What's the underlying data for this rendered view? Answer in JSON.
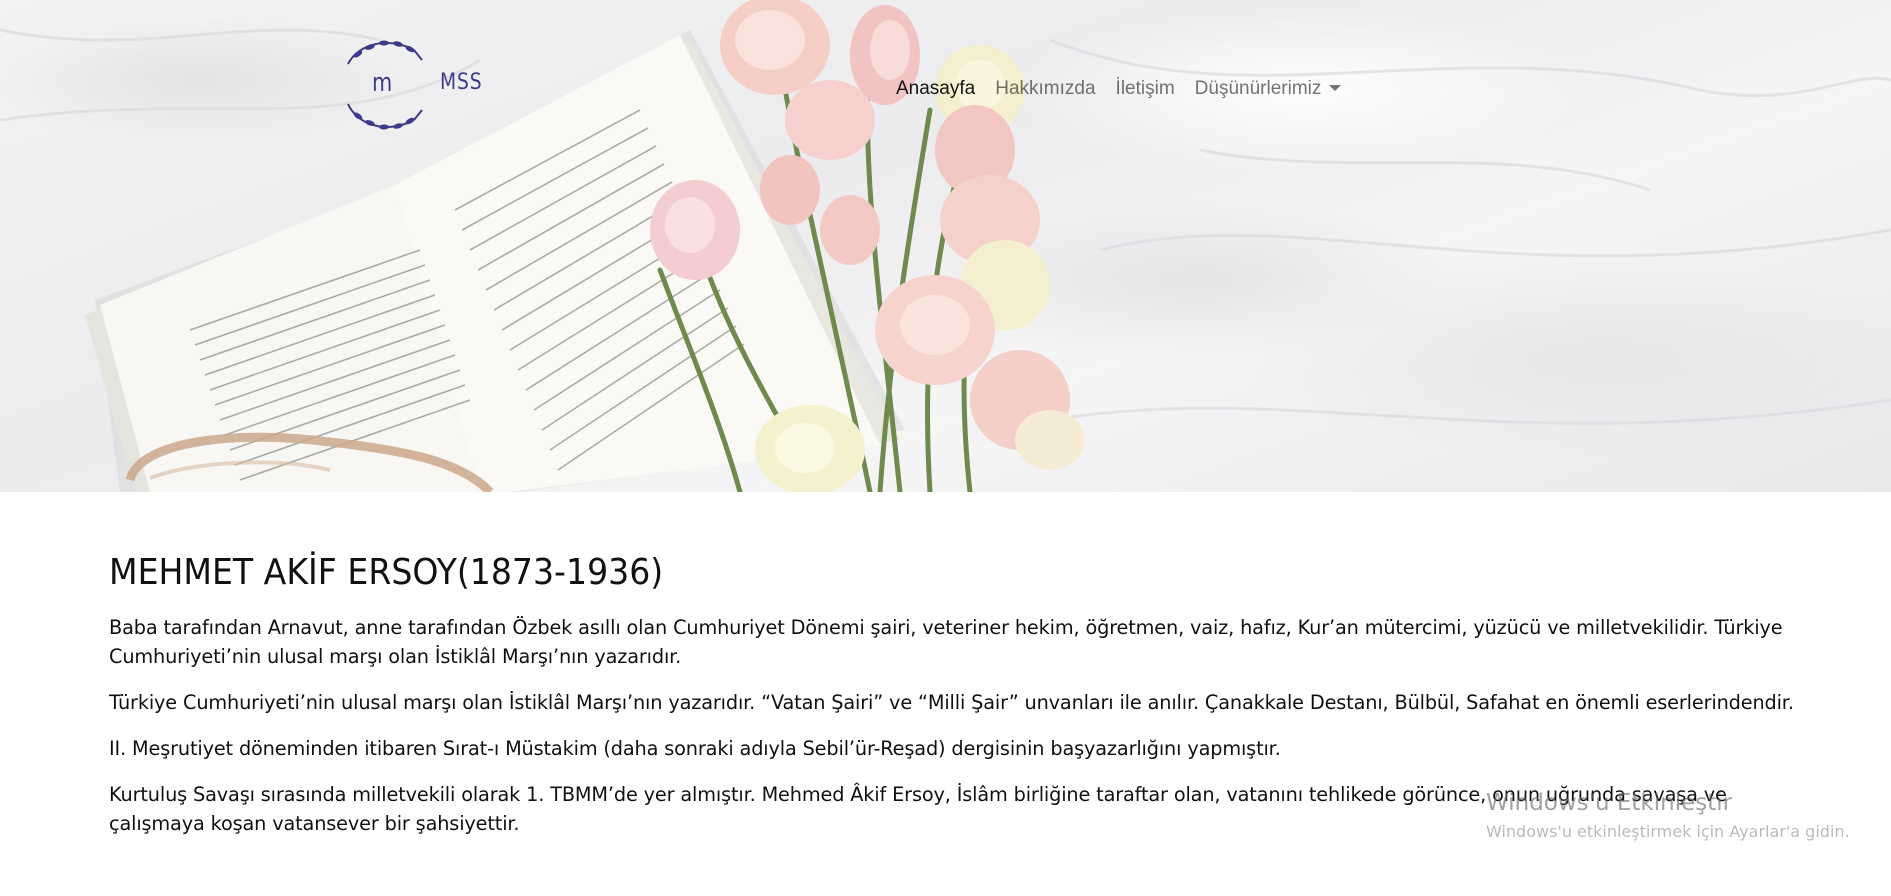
{
  "brand": {
    "logo_letter": "m",
    "logo_text": "MSS",
    "accent_color": "#3d3a8a"
  },
  "nav": {
    "items": [
      {
        "label": "Anasayfa",
        "active": true
      },
      {
        "label": "Hakkımızda",
        "active": false
      },
      {
        "label": "İletişim",
        "active": false
      },
      {
        "label": "Düşünürlerimiz",
        "active": false,
        "dropdown": true
      }
    ]
  },
  "hero": {
    "image": "book-flowers-glasses-photo"
  },
  "article": {
    "title": "MEHMET AKİF ERSOY(1873-1936)",
    "paragraphs": [
      "Baba tarafından Arnavut, anne tarafından Özbek asıllı olan Cumhuriyet Dönemi şairi, veteriner hekim, öğretmen, vaiz, hafız, Kur’an mütercimi, yüzücü ve milletvekilidir. Türkiye Cumhuriyeti’nin ulusal marşı olan İstiklâl Marşı’nın yazarıdır.",
      "Türkiye Cumhuriyeti’nin ulusal marşı olan İstiklâl Marşı’nın yazarıdır. “Vatan Şairi” ve “Milli Şair” unvanları ile anılır. Çanakkale Destanı, Bülbül, Safahat en önemli eserlerindendir.",
      "II. Meşrutiyet döneminden itibaren Sırat-ı Müstakim (daha sonraki adıyla Sebil’ür-Reşad) dergisinin başyazarlığını yapmıştır.",
      "Kurtuluş Savaşı sırasında milletvekili olarak 1. TBMM’de yer almıştır. Mehmed Âkif Ersoy, İslâm birliğine taraftar olan, vatanını tehlikede görünce, onun uğrunda savaşa ve çalışmaya koşan vatansever bir şahsiyettir."
    ]
  },
  "watermark": {
    "title": "Windows'u Etkinleştir",
    "subtitle": "Windows'u etkinleştirmek için Ayarlar'a gidin."
  }
}
